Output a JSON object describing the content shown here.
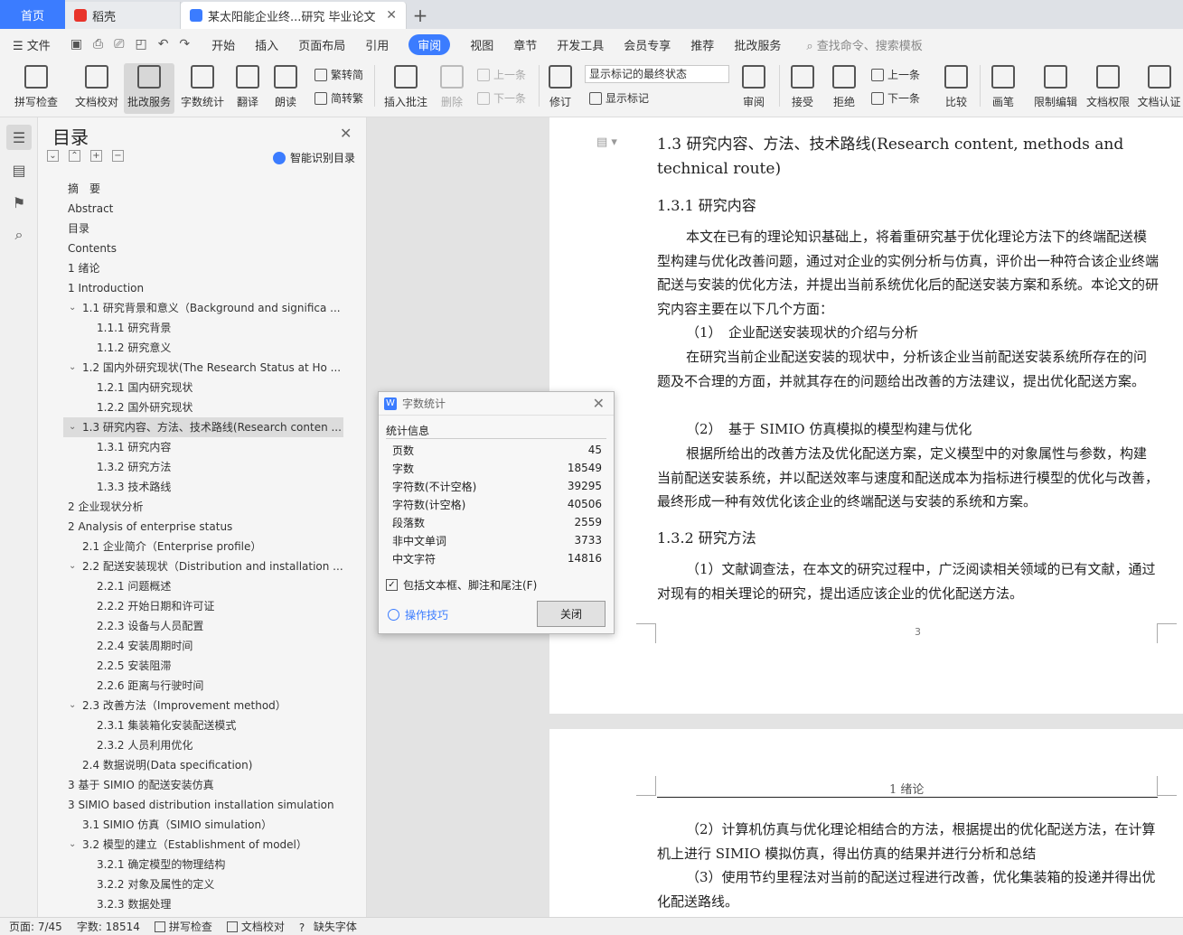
{
  "tabs": {
    "home": "首页",
    "daoke": "稻壳",
    "doc": "某太阳能企业终...研究 毕业论文"
  },
  "menu": {
    "file": "文件",
    "items": [
      "开始",
      "插入",
      "页面布局",
      "引用",
      "审阅",
      "视图",
      "章节",
      "开发工具",
      "会员专享",
      "推荐",
      "批改服务"
    ],
    "search": "查找命令、搜索模板"
  },
  "ribbon": {
    "spellcheck": "拼写检查",
    "proofread": "文档校对",
    "correction": "批改服务",
    "wordcount": "字数统计",
    "translate": "翻译",
    "read": "朗读",
    "trad": "繁转简",
    "simp": "简转繁",
    "insert_comment": "插入批注",
    "delete": "删除",
    "prev": "上一条",
    "next": "下一条",
    "revise": "修订",
    "markup_state": "显示标记的最终状态",
    "show_markup": "显示标记",
    "review": "审阅",
    "accept": "接受",
    "reject": "拒绝",
    "prev2": "上一条",
    "next2": "下一条",
    "compare": "比较",
    "pen": "画笔",
    "restrict": "限制编辑",
    "permission": "文档权限",
    "certify": "文档认证"
  },
  "toc": {
    "title": "目录",
    "smart": "智能识别目录",
    "items": [
      "摘　要",
      "Abstract",
      "目录",
      "Contents",
      "1 绪论",
      "1 Introduction",
      "1.1 研究背景和意义（Background and significa ...",
      "1.1.1 研究背景",
      "1.1.2 研究意义",
      "1.2 国内外研究现状(The Research Status at Ho ...",
      "1.2.1 国内研究现状",
      "1.2.2 国外研究现状",
      "1.3 研究内容、方法、技术路线(Research conten ...",
      "1.3.1 研究内容",
      "1.3.2 研究方法",
      "1.3.3 技术路线",
      "2 企业现状分析",
      "2 Analysis of enterprise status",
      "2.1 企业简介（Enterprise profile）",
      "2.2 配送安装现状（Distribution and installation ...",
      "2.2.1 问题概述",
      "2.2.2 开始日期和许可证",
      "2.2.3 设备与人员配置",
      "2.2.4 安装周期时间",
      "2.2.5 安装阻滞",
      "2.2.6 距离与行驶时间",
      "2.3 改善方法（Improvement method）",
      "2.3.1 集装箱化安装配送模式",
      "2.3.2 人员利用优化",
      "2.4 数据说明(Data specification)",
      "3 基于 SIMIO 的配送安装仿真",
      "3 SIMIO based distribution installation simulation",
      "3.1 SIMIO 仿真（SIMIO simulation）",
      "3.2 模型的建立（Establishment of model）",
      "3.2.1 确定模型的物理结构",
      "3.2.2 对象及属性的定义",
      "3.2.3 数据处理"
    ]
  },
  "document": {
    "h2": "1.3  研究内容、方法、技术路线(Research content, methods and technical route)",
    "h3a": "1.3.1  研究内容",
    "p1": "本文在已有的理论知识基础上，将着重研究基于优化理论方法下的终端配送模型构建与优化改善问题，通过对企业的实例分析与仿真，评价出一种符合该企业终端配送与安装的优化方法，并提出当前系统优化后的配送安装方案和系统。本论文的研究内容主要在以下几个方面：",
    "l1": "（1）　企业配送安装现状的介绍与分析",
    "p2": "在研究当前企业配送安装的现状中，分析该企业当前配送安装系统所存在的问题及不合理的方面，并就其存在的问题给出改善的方法建议，提出优化配送方案。",
    "l2": "（2）　基于 SIMIO 仿真模拟的模型构建与优化",
    "p3": "根据所给出的改善方法及优化配送方案，定义模型中的对象属性与参数，构建当前配送安装系统，并以配送效率与速度和配送成本为指标进行模型的优化与改善，最终形成一种有效优化该企业的终端配送与安装的系统和方案。",
    "h3b": "1.3.2  研究方法",
    "p4": "（1）文献调查法，在本文的研究过程中，广泛阅读相关领域的已有文献，通过对现有的相关理论的研究，提出适应该企业的优化配送方法。",
    "page_num": "3",
    "header2": "1  绪论",
    "p5": "（2）计算机仿真与优化理论相结合的方法，根据提出的优化配送方法，在计算机上进行 SIMIO 模拟仿真，得出仿真的结果并进行分析和总结",
    "p6": "（3）使用节约里程法对当前的配送过程进行改善，优化集装箱的投递并得出优化配送路线。"
  },
  "dialog": {
    "title": "字数统计",
    "section": "统计信息",
    "rows": [
      {
        "label": "页数",
        "value": "45"
      },
      {
        "label": "字数",
        "value": "18549"
      },
      {
        "label": "字符数(不计空格)",
        "value": "39295"
      },
      {
        "label": "字符数(计空格)",
        "value": "40506"
      },
      {
        "label": "段落数",
        "value": "2559"
      },
      {
        "label": "非中文单词",
        "value": "3733"
      },
      {
        "label": "中文字符",
        "value": "14816"
      }
    ],
    "include": "包括文本框、脚注和尾注(F)",
    "tips": "操作技巧",
    "close": "关闭"
  },
  "status": {
    "page": "页面: 7/45",
    "words": "字数: 18514",
    "spell": "拼写检查",
    "proof": "文档校对",
    "missing_font": "缺失字体"
  },
  "colors": {
    "accent": "#3b7cff"
  }
}
